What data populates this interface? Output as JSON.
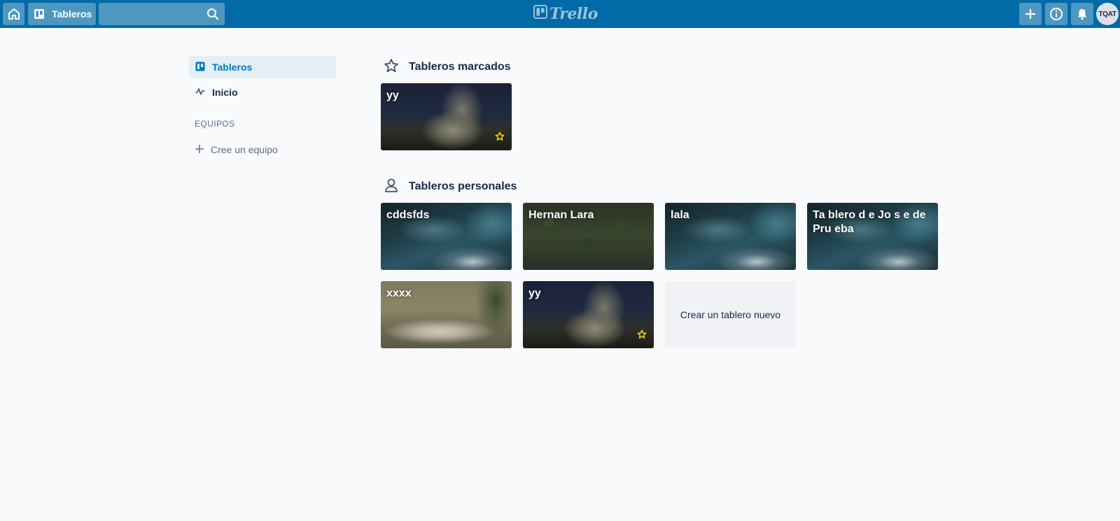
{
  "header": {
    "boards_label": "Tableros",
    "logo_text": "Trello",
    "avatar_initials": "TQAT",
    "search_value": "",
    "color": "#026aa7"
  },
  "sidebar": {
    "items": [
      {
        "label": "Tableros",
        "icon": "board-icon",
        "active": true
      },
      {
        "label": "Inicio",
        "icon": "activity-icon",
        "active": false
      }
    ],
    "section_title": "EQUIPOS",
    "create_team": "Cree un equipo"
  },
  "starred": {
    "heading": "Tableros marcados",
    "icon": "star-outline-icon",
    "boards": [
      {
        "title": "yy",
        "background": "night-rock",
        "starred": true
      }
    ]
  },
  "personal": {
    "heading": "Tableros personales",
    "icon": "person-icon",
    "boards": [
      {
        "title": "cddsfds",
        "background": "ocean",
        "starred": false
      },
      {
        "title": "Hernan Lara",
        "background": "forest",
        "starred": false
      },
      {
        "title": "lala",
        "background": "ocean",
        "starred": false
      },
      {
        "title": "Ta blero d e Jo s e de Pru eba",
        "background": "ocean",
        "starred": false
      },
      {
        "title": "xxxx",
        "background": "road",
        "starred": false
      },
      {
        "title": "yy",
        "background": "night-rock",
        "starred": true
      }
    ],
    "create_label": "Crear un tablero nuevo"
  },
  "colors": {
    "accent": "#0079bf",
    "star": "#f2d600",
    "active_bg": "#e4f0f6"
  }
}
